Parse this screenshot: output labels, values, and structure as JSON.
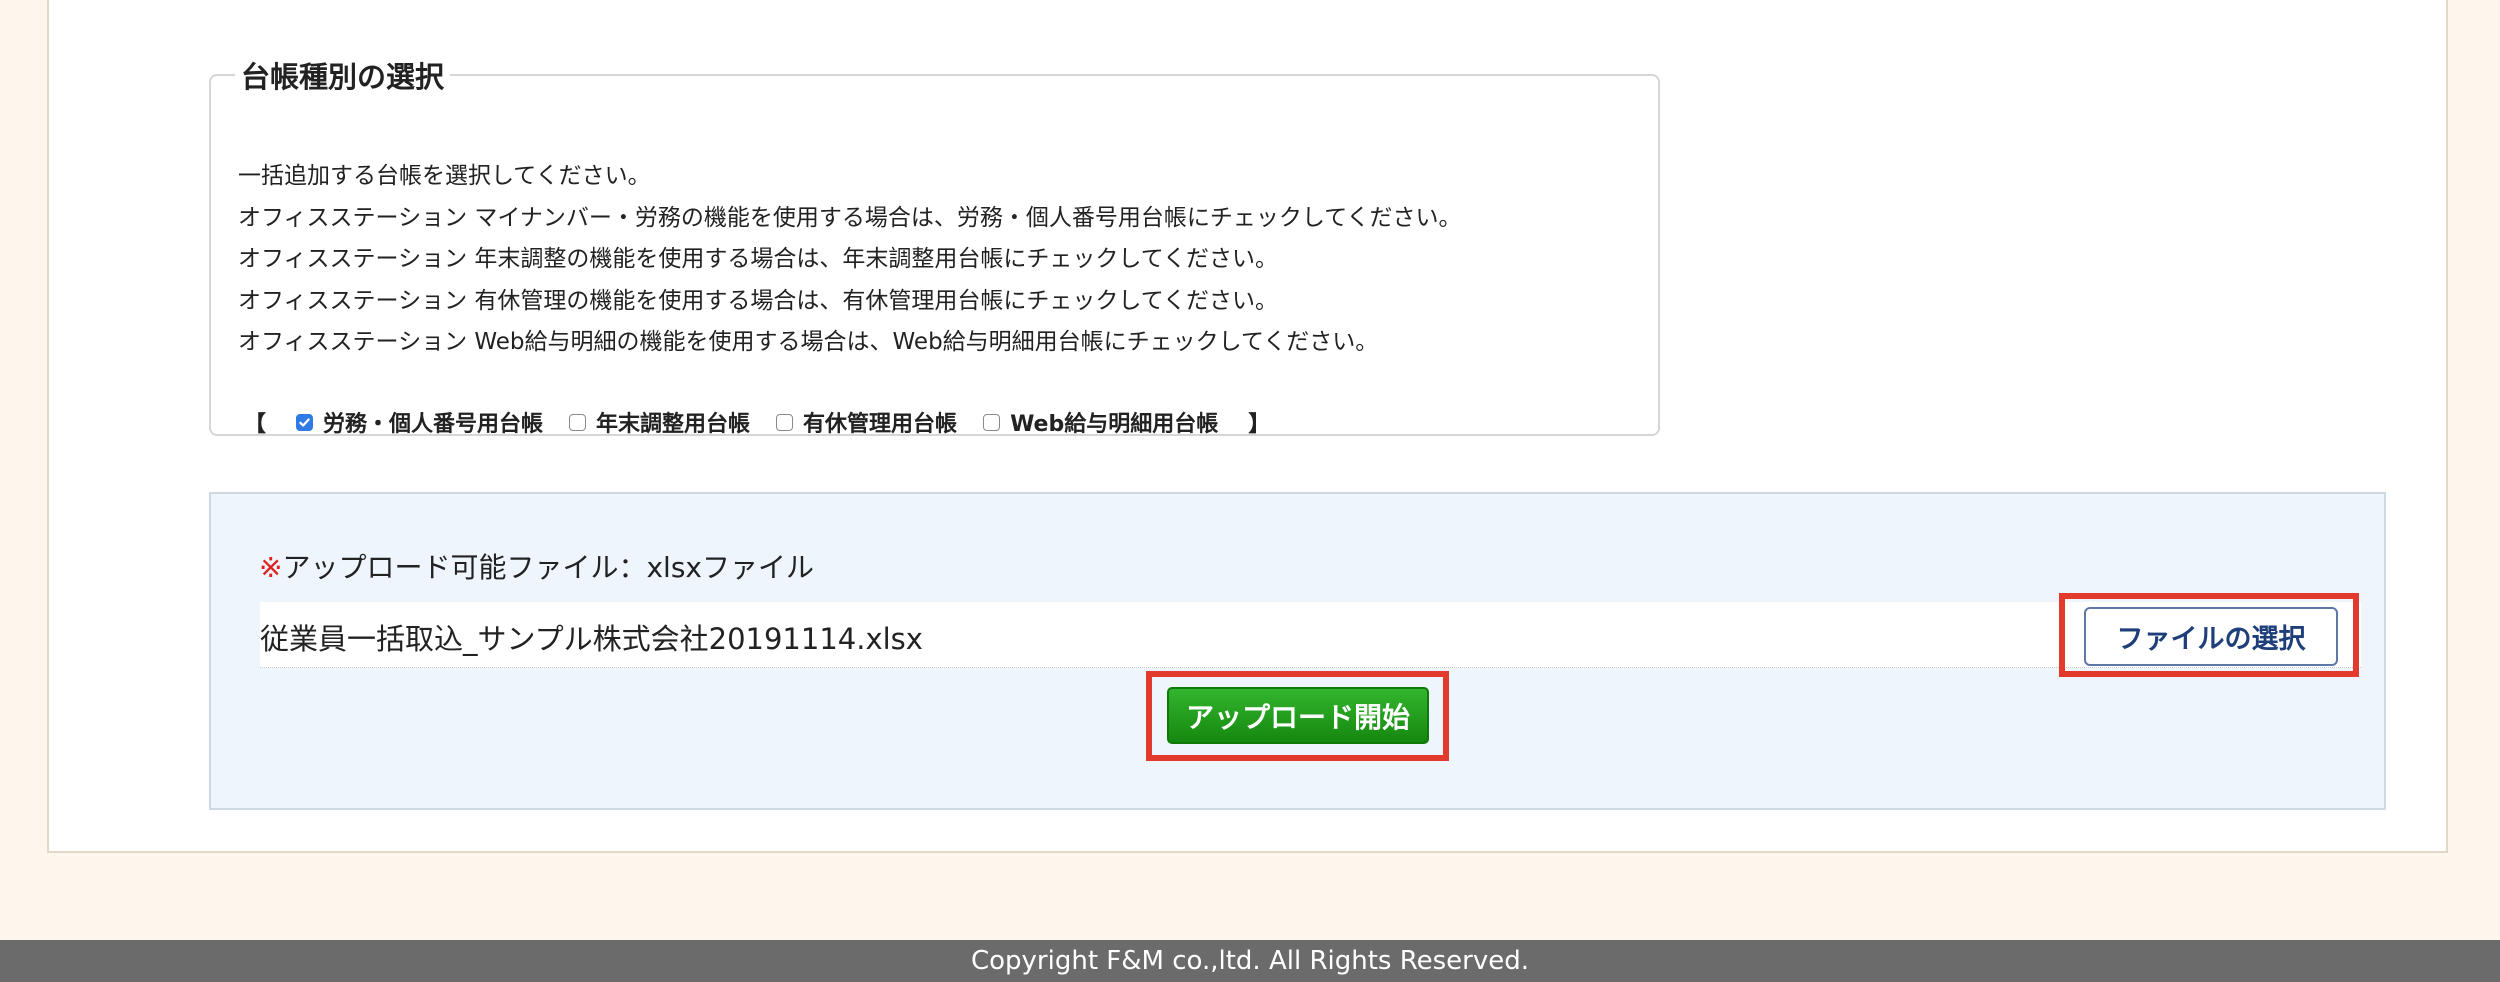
{
  "ledger_section": {
    "title": "台帳種別の選択",
    "instructions": [
      "一括追加する台帳を選択してください。",
      "オフィスステーション マイナンバー・労務の機能を使用する場合は、労務・個人番号用台帳にチェックしてください。",
      "オフィスステーション 年末調整の機能を使用する場合は、年末調整用台帳にチェックしてください。",
      "オフィスステーション 有休管理の機能を使用する場合は、有休管理用台帳にチェックしてください。",
      "オフィスステーション Web給与明細の機能を使用する場合は、Web給与明細用台帳にチェックしてください。"
    ],
    "bracket_open": "【",
    "bracket_close": "】",
    "options": [
      {
        "label": "労務・個人番号用台帳",
        "checked": true
      },
      {
        "label": "年末調整用台帳",
        "checked": false
      },
      {
        "label": "有休管理用台帳",
        "checked": false
      },
      {
        "label": "Web給与明細用台帳",
        "checked": false
      }
    ]
  },
  "upload": {
    "note_asterisk": "※",
    "note_text": "アップロード可能ファイル：xlsxファイル",
    "file_name": "従業員一括取込_サンプル株式会社20191114.xlsx",
    "select_file_label": "ファイルの選択",
    "start_upload_label": "アップロード開始"
  },
  "footer": {
    "copyright": "Copyright F&M co.,ltd. All Rights Reserved."
  },
  "colors": {
    "highlight": "#e23a2c",
    "start_button": "#1f9a19",
    "checkbox_checked": "#2f7ae5"
  }
}
